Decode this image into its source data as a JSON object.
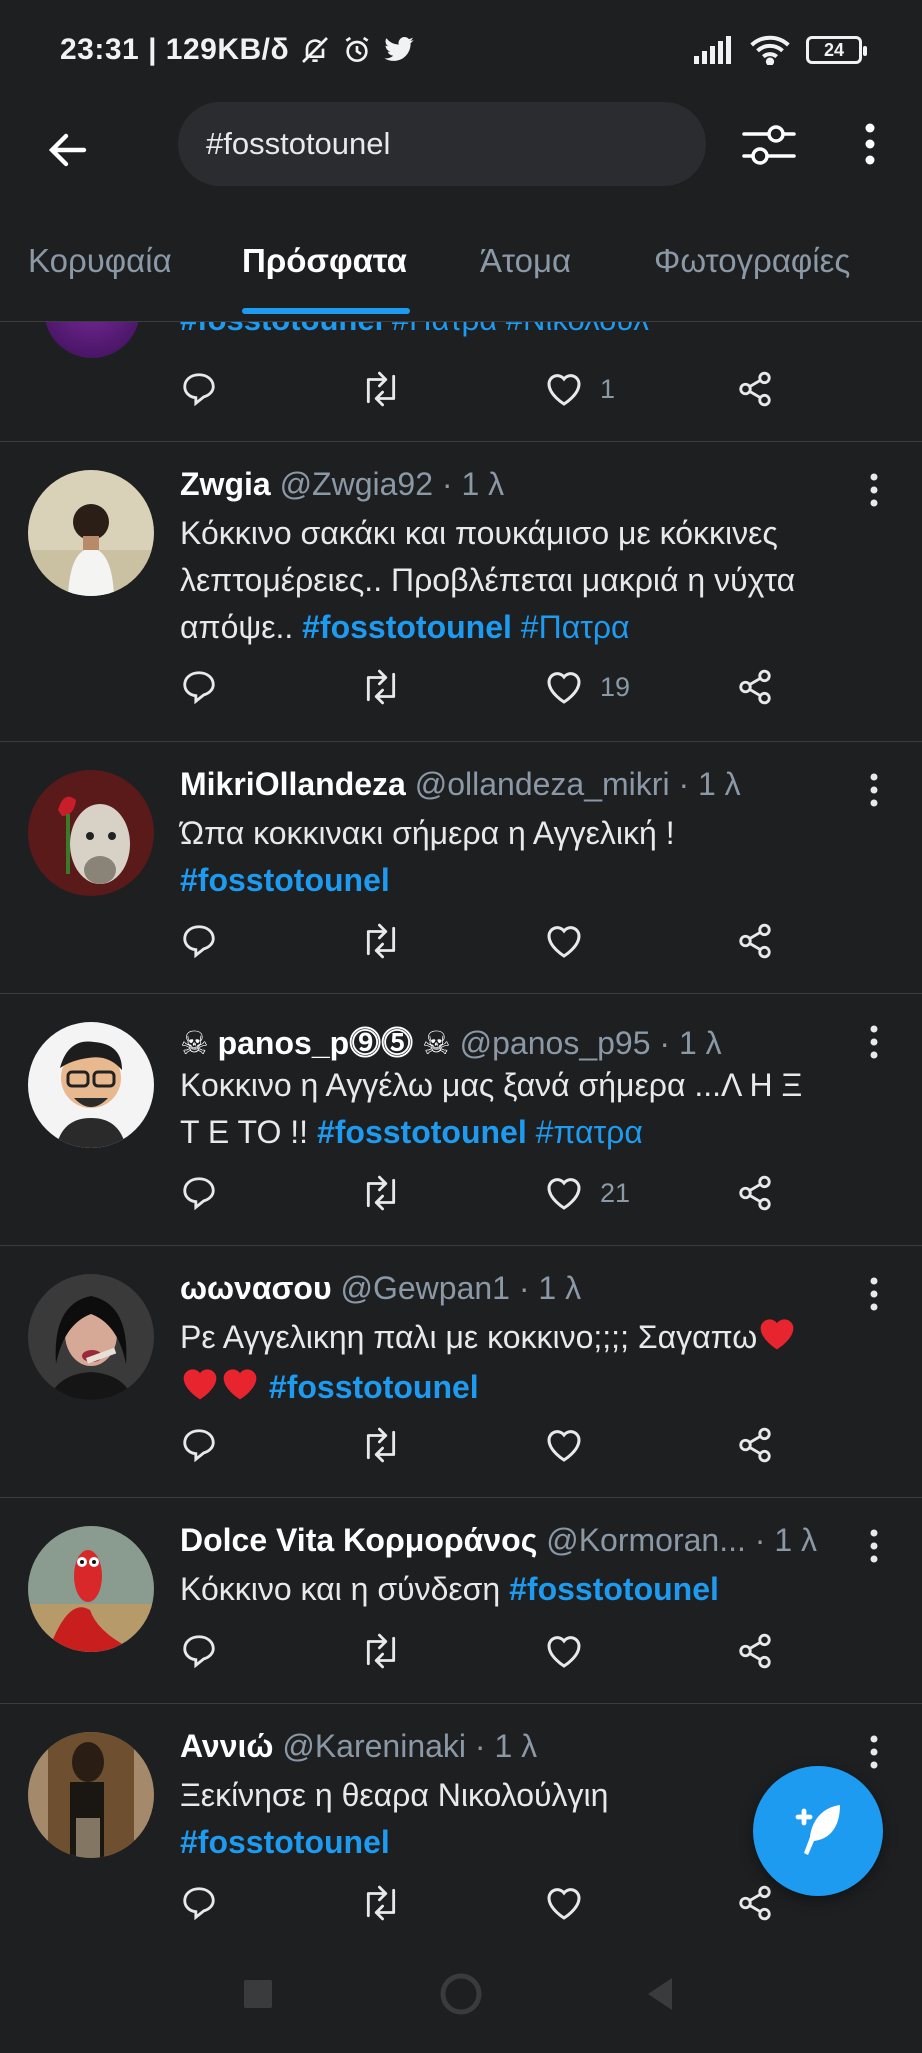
{
  "status": {
    "time_text": "23:31 | 129KB/δ",
    "battery": "24"
  },
  "search": {
    "query": "#fosstotounel"
  },
  "tabs": [
    {
      "label": "Κορυφαία"
    },
    {
      "label": "Πρόσφατα"
    },
    {
      "label": "Άτομα"
    },
    {
      "label": "Φωτογραφίες"
    }
  ],
  "partial": {
    "tags": "#fosstotounel",
    "tags_rest": " #Πατρα #Νικολούλ",
    "likes": "1"
  },
  "tweets": [
    {
      "name": "Zwgia",
      "handle": "@Zwgia92 · 1 λ",
      "line1": "Κόκκινο σακάκι και πουκάμισο με κόκκινες",
      "line2": "λεπτομέρειες.. Προβλέπεται μακριά η νύχτα",
      "line3_text": "απόψε.. ",
      "tag": "#fosstotounel",
      "tag2": " #Πατρα",
      "likes": "19"
    },
    {
      "name": "MikriOllandeza",
      "handle": "@ollandeza_mikri · 1 λ",
      "line1": "Ώπα κοκκινακι σήμερα η Αγγελική !",
      "tag": "#fosstotounel",
      "likes": ""
    },
    {
      "name": "☠ panos_p⓽⓹ ☠",
      "handle": "@panos_p95 · 1 λ",
      "line1": "Κοκκινο η Αγγέλω μας ξανά σήμερα ...Λ Η Ξ",
      "line2_text": "Τ Ε  ΤΟ !! ",
      "tag": "#fosstotounel",
      "tag2": " #πατρα",
      "likes": "21"
    },
    {
      "name": "ωωνασου",
      "handle": "@Gewpan1 · 1 λ",
      "line1": "Ρε Αγγελικηη παλι με κοκκινο;;;; Σαγαπω",
      "tag": "#fosstotounel",
      "likes": ""
    },
    {
      "name": "Dolce Vita Κορμοράνος",
      "handle": "@Kormoran... · 1 λ",
      "line1": "Κόκκινο και η σύνδεση ",
      "tag": "#fosstotounel",
      "likes": ""
    },
    {
      "name": "Αννιώ",
      "handle": "@Kareninaki · 1 λ",
      "line1": "Ξεκίνησε η θεαρα Νικολούλγιη",
      "tag": "#fosstotounel",
      "likes": ""
    }
  ]
}
